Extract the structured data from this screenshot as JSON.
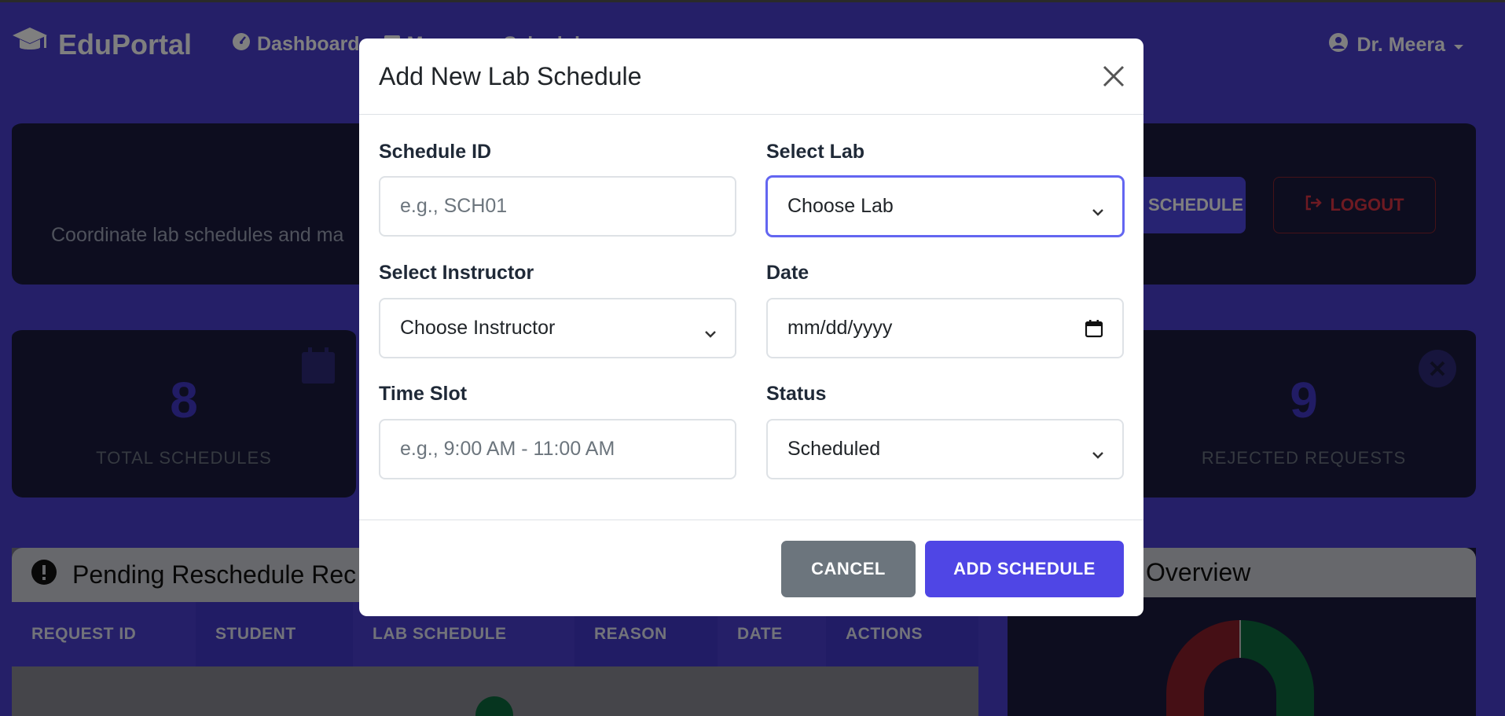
{
  "navbar": {
    "brand": "EduPortal",
    "links": [
      "Dashboard",
      "Manage",
      "Schedule"
    ],
    "user": "Dr. Meera"
  },
  "hero": {
    "subtitle": "Coordinate lab schedules and ma",
    "add_button": "SCHEDULE",
    "logout_button": "LOGOUT"
  },
  "stats": [
    {
      "value": "8",
      "label": "TOTAL SCHEDULES"
    },
    {
      "value": "9",
      "label": "REJECTED REQUESTS"
    }
  ],
  "pending": {
    "title": "Pending Reschedule Rec",
    "columns": [
      "REQUEST ID",
      "STUDENT",
      "LAB SCHEDULE",
      "REASON",
      "DATE",
      "ACTIONS"
    ]
  },
  "overview": {
    "title": "Overview"
  },
  "modal": {
    "title": "Add New Lab Schedule",
    "schedule_id": {
      "label": "Schedule ID",
      "placeholder": "e.g., SCH01",
      "value": ""
    },
    "lab": {
      "label": "Select Lab",
      "selected": "Choose Lab"
    },
    "instructor": {
      "label": "Select Instructor",
      "selected": "Choose Instructor"
    },
    "date": {
      "label": "Date",
      "placeholder": "mm/dd/yyyy"
    },
    "time_slot": {
      "label": "Time Slot",
      "placeholder": "e.g., 9:00 AM - 11:00 AM",
      "value": ""
    },
    "status": {
      "label": "Status",
      "selected": "Scheduled"
    },
    "cancel_button": "CANCEL",
    "add_button": "ADD SCHEDULE"
  },
  "colors": {
    "primary": "#4f46e5",
    "secondary": "#6c757d",
    "danger": "#dc3545",
    "success": "#0c6b3e",
    "focus": "#6366f1"
  }
}
